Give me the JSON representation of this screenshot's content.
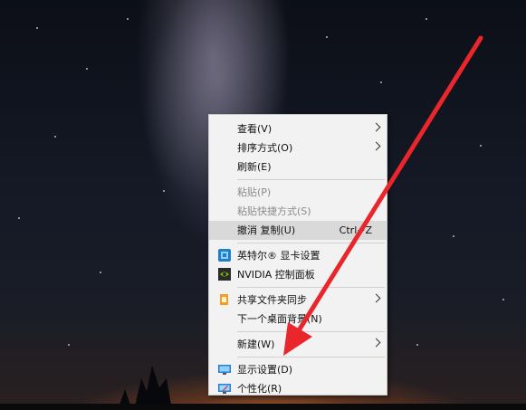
{
  "context_menu": {
    "items": [
      {
        "label": "查看(V)"
      },
      {
        "label": "排序方式(O)"
      },
      {
        "label": "刷新(E)"
      },
      {
        "label": "粘贴(P)"
      },
      {
        "label": "粘贴快捷方式(S)"
      },
      {
        "label": "撤消 复制(U)",
        "shortcut": "Ctrl+Z"
      },
      {
        "label": "英特尔® 显卡设置"
      },
      {
        "label": "NVIDIA 控制面板"
      },
      {
        "label": "共享文件夹同步"
      },
      {
        "label": "下一个桌面背景(N)"
      },
      {
        "label": "新建(W)"
      },
      {
        "label": "显示设置(D)"
      },
      {
        "label": "个性化(R)"
      }
    ]
  },
  "colors": {
    "menu_bg": "#f2f2f2",
    "highlight": "#d9d9d9",
    "arrow": "#e8262b",
    "disabled_text": "#8a8a8a"
  }
}
